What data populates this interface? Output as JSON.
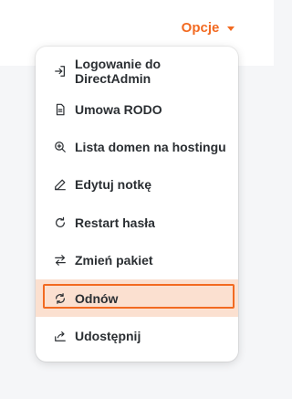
{
  "header": {
    "options_label": "Opcje"
  },
  "menu": {
    "items": [
      {
        "label": "Logowanie do DirectAdmin",
        "icon": "login-icon"
      },
      {
        "label": "Umowa RODO",
        "icon": "document-icon"
      },
      {
        "label": "Lista domen na hostingu",
        "icon": "zoom-in-icon"
      },
      {
        "label": "Edytuj notkę",
        "icon": "pencil-icon"
      },
      {
        "label": "Restart hasła",
        "icon": "refresh-icon"
      },
      {
        "label": "Zmień pakiet",
        "icon": "swap-icon"
      },
      {
        "label": "Odnów",
        "icon": "renew-icon"
      },
      {
        "label": "Udostępnij",
        "icon": "share-icon"
      }
    ]
  },
  "colors": {
    "accent": "#f26a21",
    "active_bg": "#fbe0d0",
    "text": "#2b2f33"
  }
}
